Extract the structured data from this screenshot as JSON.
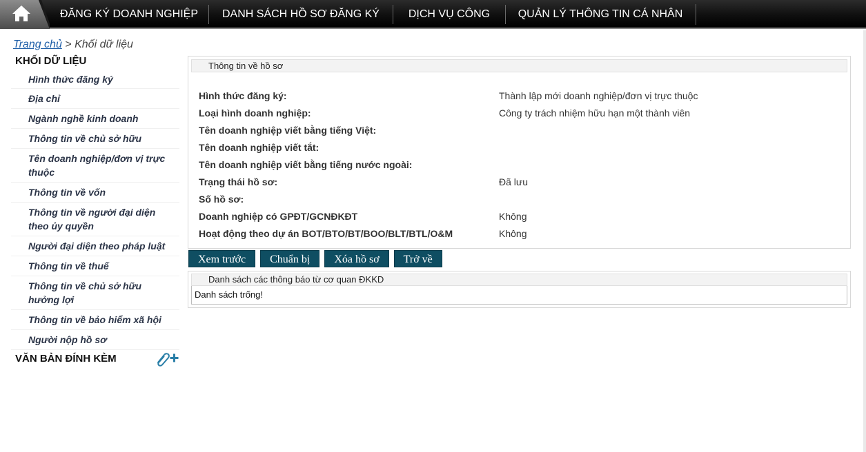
{
  "nav": {
    "home_label": "home",
    "items": [
      "ĐĂNG KÝ DOANH NGHIỆP",
      "DANH SÁCH HỒ SƠ ĐĂNG KÝ",
      "DỊCH VỤ CÔNG",
      "QUẢN LÝ THÔNG TIN CÁ NHÂN"
    ]
  },
  "breadcrumb": {
    "home": "Trang chủ",
    "separator": " > ",
    "current": "Khối dữ liệu"
  },
  "sidebar": {
    "heading": "KHỐI DỮ LIỆU",
    "items": [
      "Hình thức đăng ký",
      "Địa chỉ",
      "Ngành nghề kinh doanh",
      "Thông tin về chủ sở hữu",
      "Tên doanh nghiệp/đơn vị trực thuộc",
      "Thông tin về vốn",
      "Thông tin về người đại diện theo ủy quyền",
      "Người đại diện theo pháp luật",
      "Thông tin về thuế",
      "Thông tin về chủ sở hữu hưởng lợi",
      "Thông tin về bảo hiểm xã hội",
      "Người nộp hồ sơ"
    ],
    "attachments_heading": "VĂN BẢN ĐÍNH KÈM"
  },
  "profile_panel": {
    "title": "Thông tin về hồ sơ",
    "rows": [
      {
        "label": "Hình thức đăng ký:",
        "value": "Thành lập mới doanh nghiệp/đơn vị trực thuộc"
      },
      {
        "label": "Loại hình doanh nghiệp:",
        "value": "Công ty trách nhiệm hữu hạn một thành viên"
      },
      {
        "label": "Tên doanh nghiệp viết bằng tiếng Việt:",
        "value": ""
      },
      {
        "label": "Tên doanh nghiệp viết tắt:",
        "value": ""
      },
      {
        "label": "Tên doanh nghiệp viết bằng tiếng nước ngoài:",
        "value": ""
      },
      {
        "label": "Trạng thái hồ sơ:",
        "value": "Đã lưu"
      },
      {
        "label": "Số hồ sơ:",
        "value": ""
      },
      {
        "label": "Doanh nghiệp có GPĐT/GCNĐKĐT",
        "value": "Không"
      },
      {
        "label": "Hoạt động theo dự án BOT/BTO/BT/BOO/BLT/BTL/O&M",
        "value": "Không"
      }
    ]
  },
  "buttons": {
    "preview": "Xem trước",
    "prepare": "Chuẩn bị",
    "delete": "Xóa hồ sơ",
    "back": "Trở về"
  },
  "notices_panel": {
    "title": "Danh sách các thông báo từ cơ quan ĐKKD",
    "empty_text": "Danh sách trống!"
  },
  "colors": {
    "nav_bg": "#000000",
    "button_bg": "#0f4e62",
    "link": "#1f5fa8",
    "attach_icon": "#2a7fa8"
  }
}
